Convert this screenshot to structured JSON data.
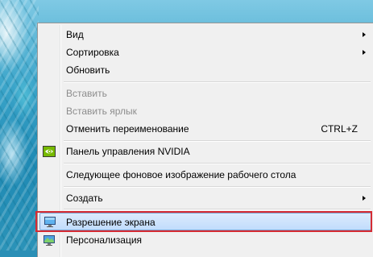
{
  "menu": {
    "items": [
      {
        "label": "Вид",
        "submenu": true,
        "disabled": false
      },
      {
        "label": "Сортировка",
        "submenu": true,
        "disabled": false
      },
      {
        "label": "Обновить",
        "submenu": false,
        "disabled": false
      },
      {
        "label": "Вставить",
        "submenu": false,
        "disabled": true
      },
      {
        "label": "Вставить ярлык",
        "submenu": false,
        "disabled": true
      },
      {
        "label": "Отменить переименование",
        "shortcut": "CTRL+Z",
        "submenu": false,
        "disabled": false
      },
      {
        "label": "Панель управления NVIDIA",
        "icon": "nvidia-icon",
        "submenu": false,
        "disabled": false
      },
      {
        "label": "Следующее фоновое изображение рабочего стола",
        "submenu": false,
        "disabled": false
      },
      {
        "label": "Создать",
        "submenu": true,
        "disabled": false
      },
      {
        "label": "Разрешение экрана",
        "icon": "display-resolution-icon",
        "highlighted": true,
        "annotated": true,
        "submenu": false,
        "disabled": false
      },
      {
        "label": "Персонализация",
        "icon": "personalization-icon",
        "submenu": false,
        "disabled": false
      }
    ]
  },
  "colors": {
    "menu_background": "#f0f0f0",
    "highlight": "#c1dcfc",
    "annotation_frame": "#d52b33",
    "disabled_text": "#8d8d8d"
  }
}
